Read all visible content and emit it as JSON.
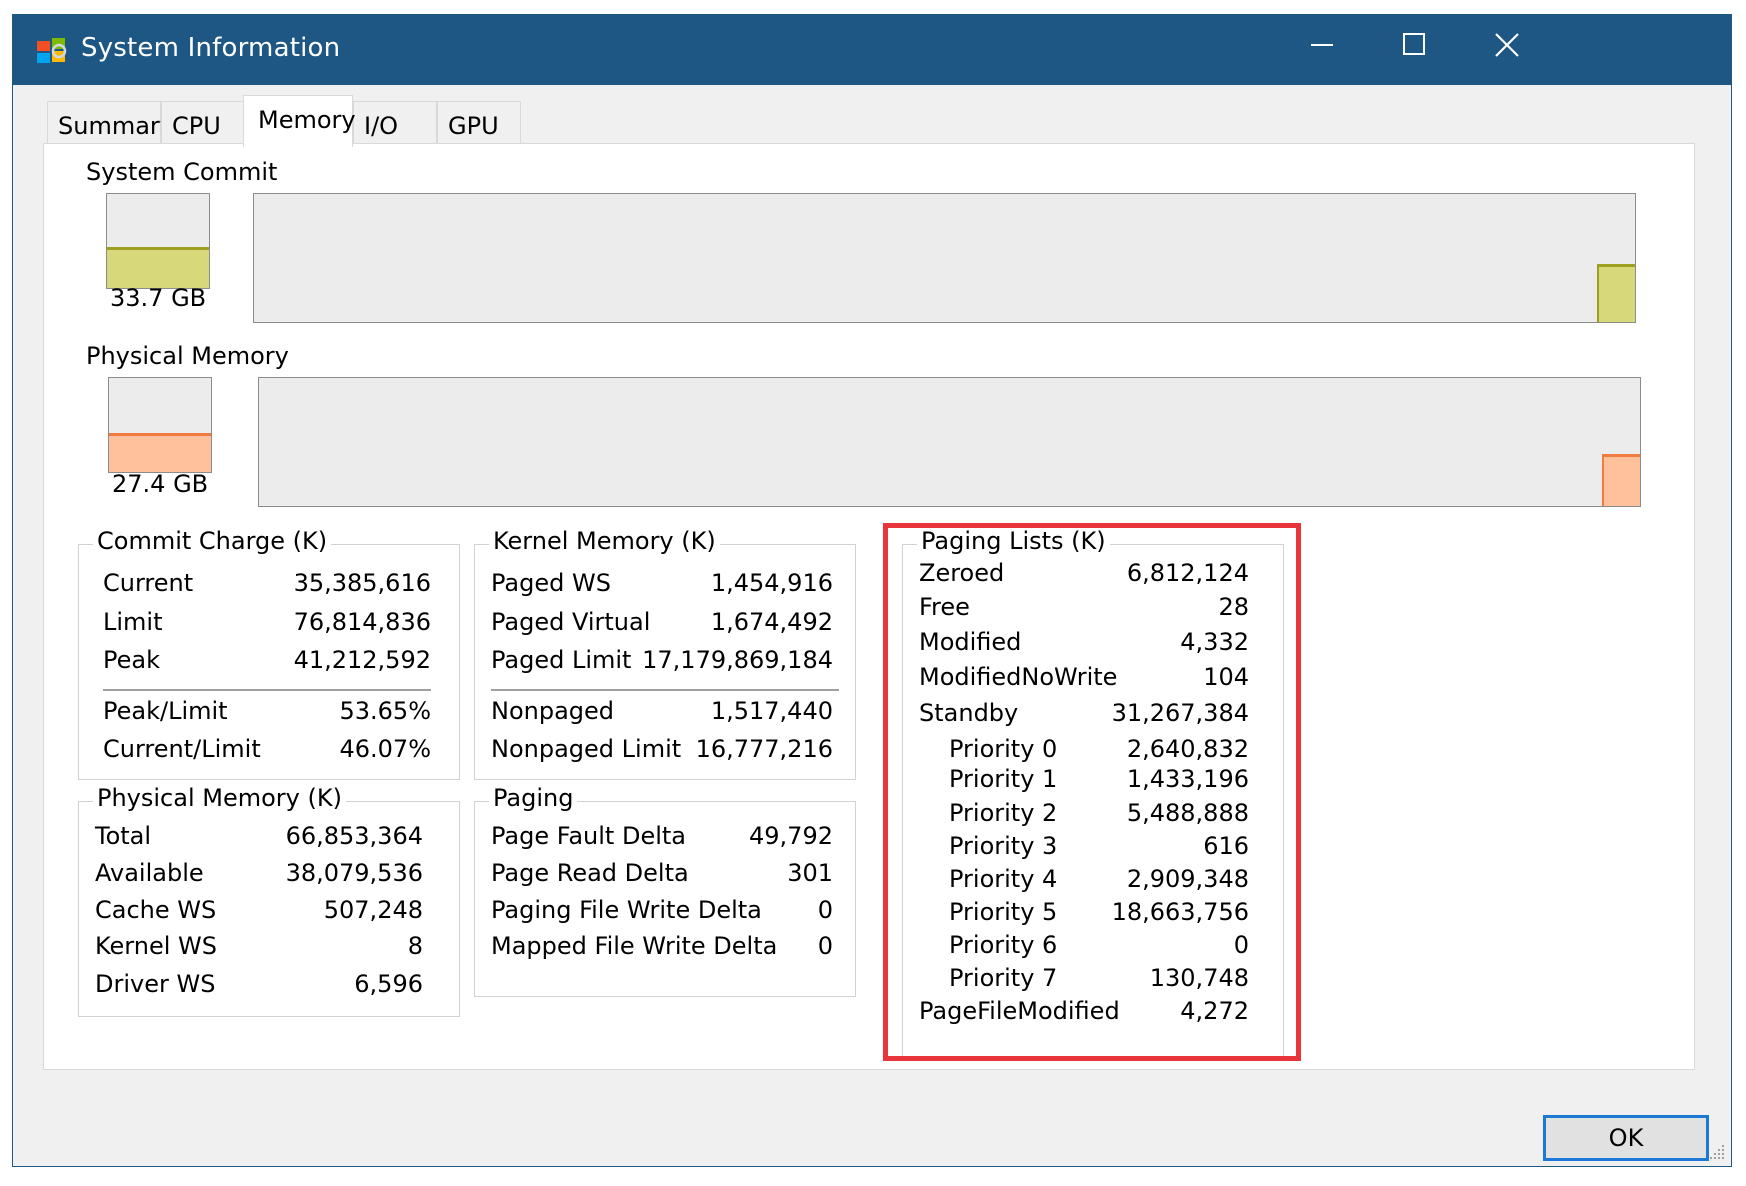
{
  "window": {
    "title": "System Information"
  },
  "tabs": [
    {
      "label": "Summary"
    },
    {
      "label": "CPU"
    },
    {
      "label": "Memory"
    },
    {
      "label": "I/O"
    },
    {
      "label": "GPU"
    }
  ],
  "active_tab": "Memory",
  "graphs": {
    "system_commit": {
      "label": "System Commit",
      "value": "33.7 GB",
      "usage_fraction": 0.44,
      "color": "#d6d87a",
      "line_color": "#a0a020"
    },
    "physical_memory": {
      "label": "Physical Memory",
      "value": "27.4 GB",
      "usage_fraction": 0.41,
      "color": "#ffc09c",
      "line_color": "#f07a40"
    }
  },
  "commit_charge": {
    "title": "Commit Charge (K)",
    "rows": [
      {
        "label": "Current",
        "value": "35,385,616"
      },
      {
        "label": "Limit",
        "value": "76,814,836"
      },
      {
        "label": "Peak",
        "value": "41,212,592"
      },
      {
        "label": "Peak/Limit",
        "value": "53.65%"
      },
      {
        "label": "Current/Limit",
        "value": "46.07%"
      }
    ]
  },
  "kernel_memory": {
    "title": "Kernel Memory (K)",
    "rows": [
      {
        "label": "Paged WS",
        "value": "1,454,916"
      },
      {
        "label": "Paged Virtual",
        "value": "1,674,492"
      },
      {
        "label": "Paged Limit",
        "value": "17,179,869,184"
      },
      {
        "label": "Nonpaged",
        "value": "1,517,440"
      },
      {
        "label": "Nonpaged Limit",
        "value": "16,777,216"
      }
    ]
  },
  "physical_memory_k": {
    "title": "Physical Memory (K)",
    "rows": [
      {
        "label": "Total",
        "value": "66,853,364"
      },
      {
        "label": "Available",
        "value": "38,079,536"
      },
      {
        "label": "Cache WS",
        "value": "507,248"
      },
      {
        "label": "Kernel WS",
        "value": "8"
      },
      {
        "label": "Driver WS",
        "value": "6,596"
      }
    ]
  },
  "paging": {
    "title": "Paging",
    "rows": [
      {
        "label": "Page Fault Delta",
        "value": "49,792"
      },
      {
        "label": "Page Read Delta",
        "value": "301"
      },
      {
        "label": "Paging File Write Delta",
        "value": "0"
      },
      {
        "label": "Mapped File Write Delta",
        "value": "0"
      }
    ]
  },
  "paging_lists": {
    "title": "Paging Lists (K)",
    "rows": [
      {
        "label": "Zeroed",
        "value": "6,812,124"
      },
      {
        "label": "Free",
        "value": "28"
      },
      {
        "label": "Modified",
        "value": "4,332"
      },
      {
        "label": "ModifiedNoWrite",
        "value": "104"
      },
      {
        "label": "Standby",
        "value": "31,267,384"
      },
      {
        "label": "Priority 0",
        "value": "2,640,832"
      },
      {
        "label": "Priority 1",
        "value": "1,433,196"
      },
      {
        "label": "Priority 2",
        "value": "5,488,888"
      },
      {
        "label": "Priority 3",
        "value": "616"
      },
      {
        "label": "Priority 4",
        "value": "2,909,348"
      },
      {
        "label": "Priority 5",
        "value": "18,663,756"
      },
      {
        "label": "Priority 6",
        "value": "0"
      },
      {
        "label": "Priority 7",
        "value": "130,748"
      },
      {
        "label": "PageFileModified",
        "value": "4,272"
      }
    ]
  },
  "buttons": {
    "ok": "OK"
  },
  "colors": {
    "titlebar": "#1e5784",
    "highlight": "#e8353c",
    "ok_border": "#1b78d4"
  },
  "icons": {
    "app": "system-information-icon",
    "minimize": "minimize-icon",
    "maximize": "maximize-icon",
    "close": "close-icon"
  }
}
